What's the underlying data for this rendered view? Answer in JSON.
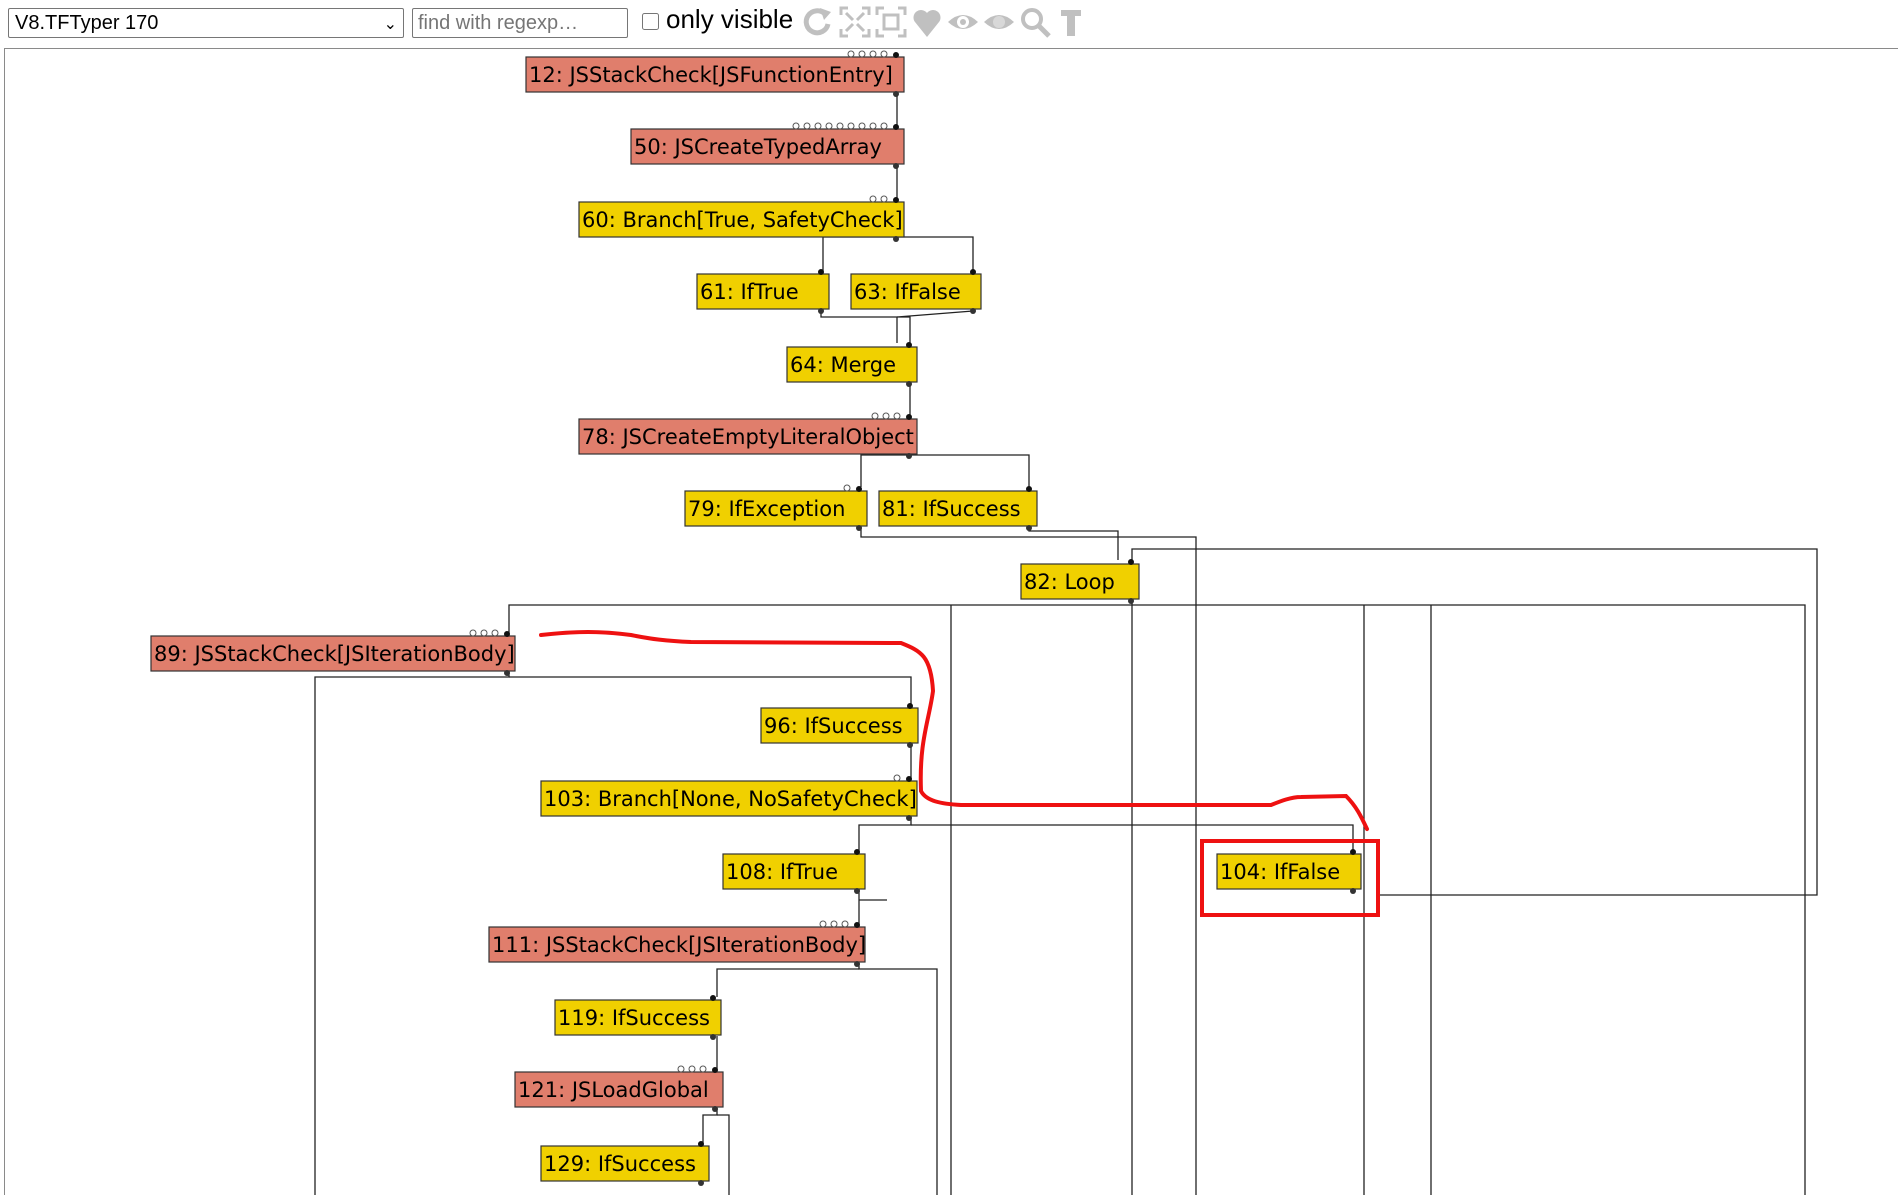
{
  "toolbar": {
    "phase_selected": "V8.TFTyper 170",
    "search_placeholder": "find with regexp…",
    "only_visible_label": "only visible",
    "icons": [
      "rearrange-icon",
      "layout-icon",
      "show-all-icon",
      "heart-icon",
      "eye-icon",
      "eye-toggle-icon",
      "zoom-icon",
      "type-icon"
    ]
  },
  "colors": {
    "control_node": "#f0d000",
    "js_node": "#e07e6c",
    "edge": "#222222",
    "annotation": "#ee1111"
  },
  "nodes": [
    {
      "id": "12",
      "label": "12: JSStackCheck[JSFunctionEntry]",
      "kind": "js"
    },
    {
      "id": "50",
      "label": "50: JSCreateTypedArray",
      "kind": "js"
    },
    {
      "id": "60",
      "label": "60: Branch[True, SafetyCheck]",
      "kind": "control"
    },
    {
      "id": "61",
      "label": "61: IfTrue",
      "kind": "control"
    },
    {
      "id": "63",
      "label": "63: IfFalse",
      "kind": "control"
    },
    {
      "id": "64",
      "label": "64: Merge",
      "kind": "control"
    },
    {
      "id": "78",
      "label": "78: JSCreateEmptyLiteralObject",
      "kind": "js"
    },
    {
      "id": "79",
      "label": "79: IfException",
      "kind": "control"
    },
    {
      "id": "81",
      "label": "81: IfSuccess",
      "kind": "control"
    },
    {
      "id": "82",
      "label": "82: Loop",
      "kind": "control"
    },
    {
      "id": "89",
      "label": "89: JSStackCheck[JSIterationBody]",
      "kind": "js"
    },
    {
      "id": "96",
      "label": "96: IfSuccess",
      "kind": "control"
    },
    {
      "id": "103",
      "label": "103: Branch[None, NoSafetyCheck]",
      "kind": "control"
    },
    {
      "id": "108",
      "label": "108: IfTrue",
      "kind": "control"
    },
    {
      "id": "104",
      "label": "104: IfFalse",
      "kind": "control",
      "highlighted": true
    },
    {
      "id": "111",
      "label": "111: JSStackCheck[JSIterationBody]",
      "kind": "js"
    },
    {
      "id": "119",
      "label": "119: IfSuccess",
      "kind": "control"
    },
    {
      "id": "121",
      "label": "121: JSLoadGlobal",
      "kind": "js"
    },
    {
      "id": "129",
      "label": "129: IfSuccess",
      "kind": "control"
    }
  ]
}
